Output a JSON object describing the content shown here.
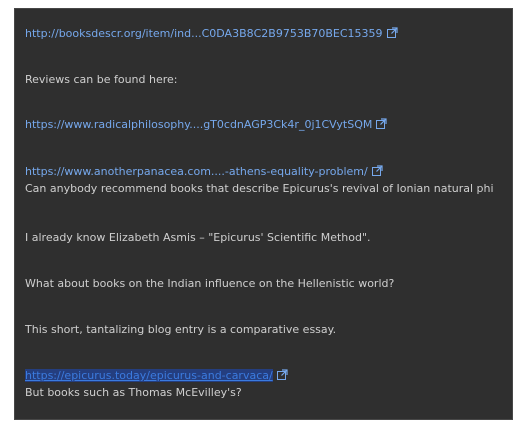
{
  "content": {
    "link1": "http://booksdescr.org/item/ind...C0DA3B8C2B9753B70BEC15359",
    "reviews_text": "Reviews can be found here:",
    "link2": "https://www.radicalphilosophy....gT0cdnAGP3Ck4r_0j1CVytSQM",
    "link3": "https://www.anotherpanacea.com....-athens-equality-problem/",
    "question1": "Can anybody recommend books that describe Epicurus's revival of Ionian natural phi",
    "asmis_text": "I already know Elizabeth Asmis – \"Epicurus' Scientific Method\".",
    "indian_question": "What about books on the Indian influence on the Hellenistic world?",
    "blog_text": "This short, tantalizing blog entry is a comparative essay.",
    "link4": "https://epicurus.today/epicurus-and-carvaca/",
    "mcevilley_text": "But books such as Thomas McEvilley's?"
  },
  "icons": {
    "external_link": "external-link-icon"
  },
  "colors": {
    "background": "#2f2f2f",
    "text": "#cfcfcf",
    "link": "#76a8ec"
  }
}
